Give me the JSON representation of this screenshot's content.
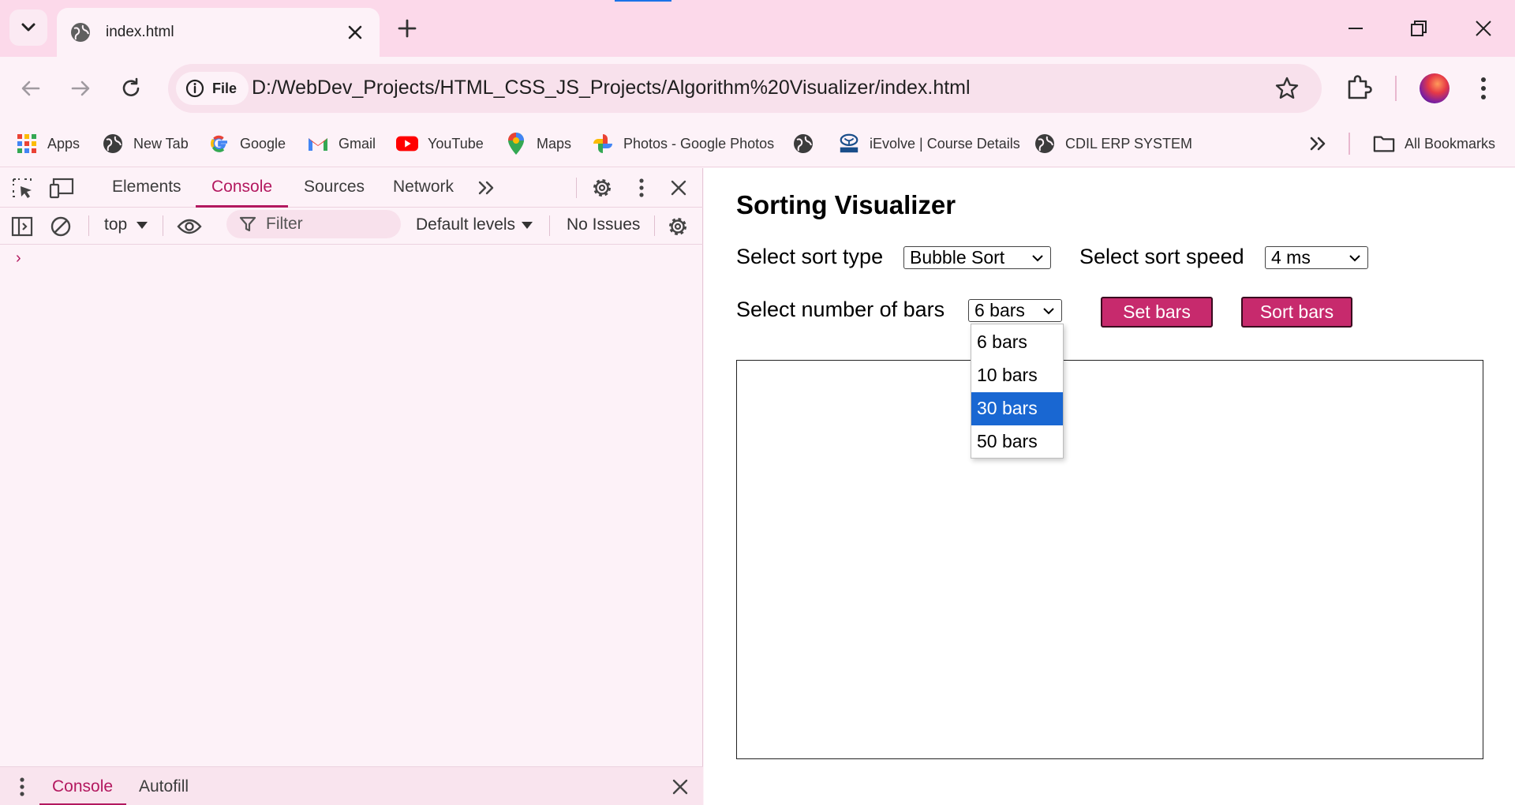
{
  "browser": {
    "tab_title": "index.html",
    "omnibox_chip": "File",
    "url": "D:/WebDev_Projects/HTML_CSS_JS_Projects/Algorithm%20Visualizer/index.html"
  },
  "bookmarks": {
    "items": [
      {
        "label": "Apps",
        "icon": "apps-grid-icon"
      },
      {
        "label": "New Tab",
        "icon": "globe-icon"
      },
      {
        "label": "Google",
        "icon": "google-icon"
      },
      {
        "label": "Gmail",
        "icon": "gmail-icon"
      },
      {
        "label": "YouTube",
        "icon": "youtube-icon"
      },
      {
        "label": "Maps",
        "icon": "maps-pin-icon"
      },
      {
        "label": "Photos - Google Photos",
        "icon": "google-photos-icon"
      },
      {
        "label": "",
        "icon": "globe-icon"
      },
      {
        "label": "iEvolve | Course Details",
        "icon": "tata-icon"
      },
      {
        "label": "CDIL ERP SYSTEM",
        "icon": "globe-icon"
      }
    ],
    "all_bookmarks": "All Bookmarks"
  },
  "devtools": {
    "tabs": [
      "Elements",
      "Console",
      "Sources",
      "Network"
    ],
    "active_tab": "Console",
    "context": "top",
    "filter_placeholder": "Filter",
    "levels": "Default levels",
    "issues": "No Issues",
    "prompt": "›",
    "drawer_tabs": [
      "Console",
      "Autofill"
    ]
  },
  "page": {
    "title": "Sorting Visualizer",
    "sort_type_label": "Select sort type",
    "sort_type_value": "Bubble Sort",
    "sort_speed_label": "Select sort speed",
    "sort_speed_value": "4 ms",
    "bars_label": "Select number of bars",
    "bars_value": "6 bars",
    "bars_options": [
      "6 bars",
      "10 bars",
      "30 bars",
      "50 bars"
    ],
    "bars_highlighted": "30 bars",
    "set_bars_button": "Set bars",
    "sort_bars_button": "Sort bars"
  },
  "colors": {
    "accent": "#b3185f",
    "button": "#c72a6d",
    "dropdown_highlight": "#1967d2",
    "tabstrip": "#fcd9ea"
  }
}
